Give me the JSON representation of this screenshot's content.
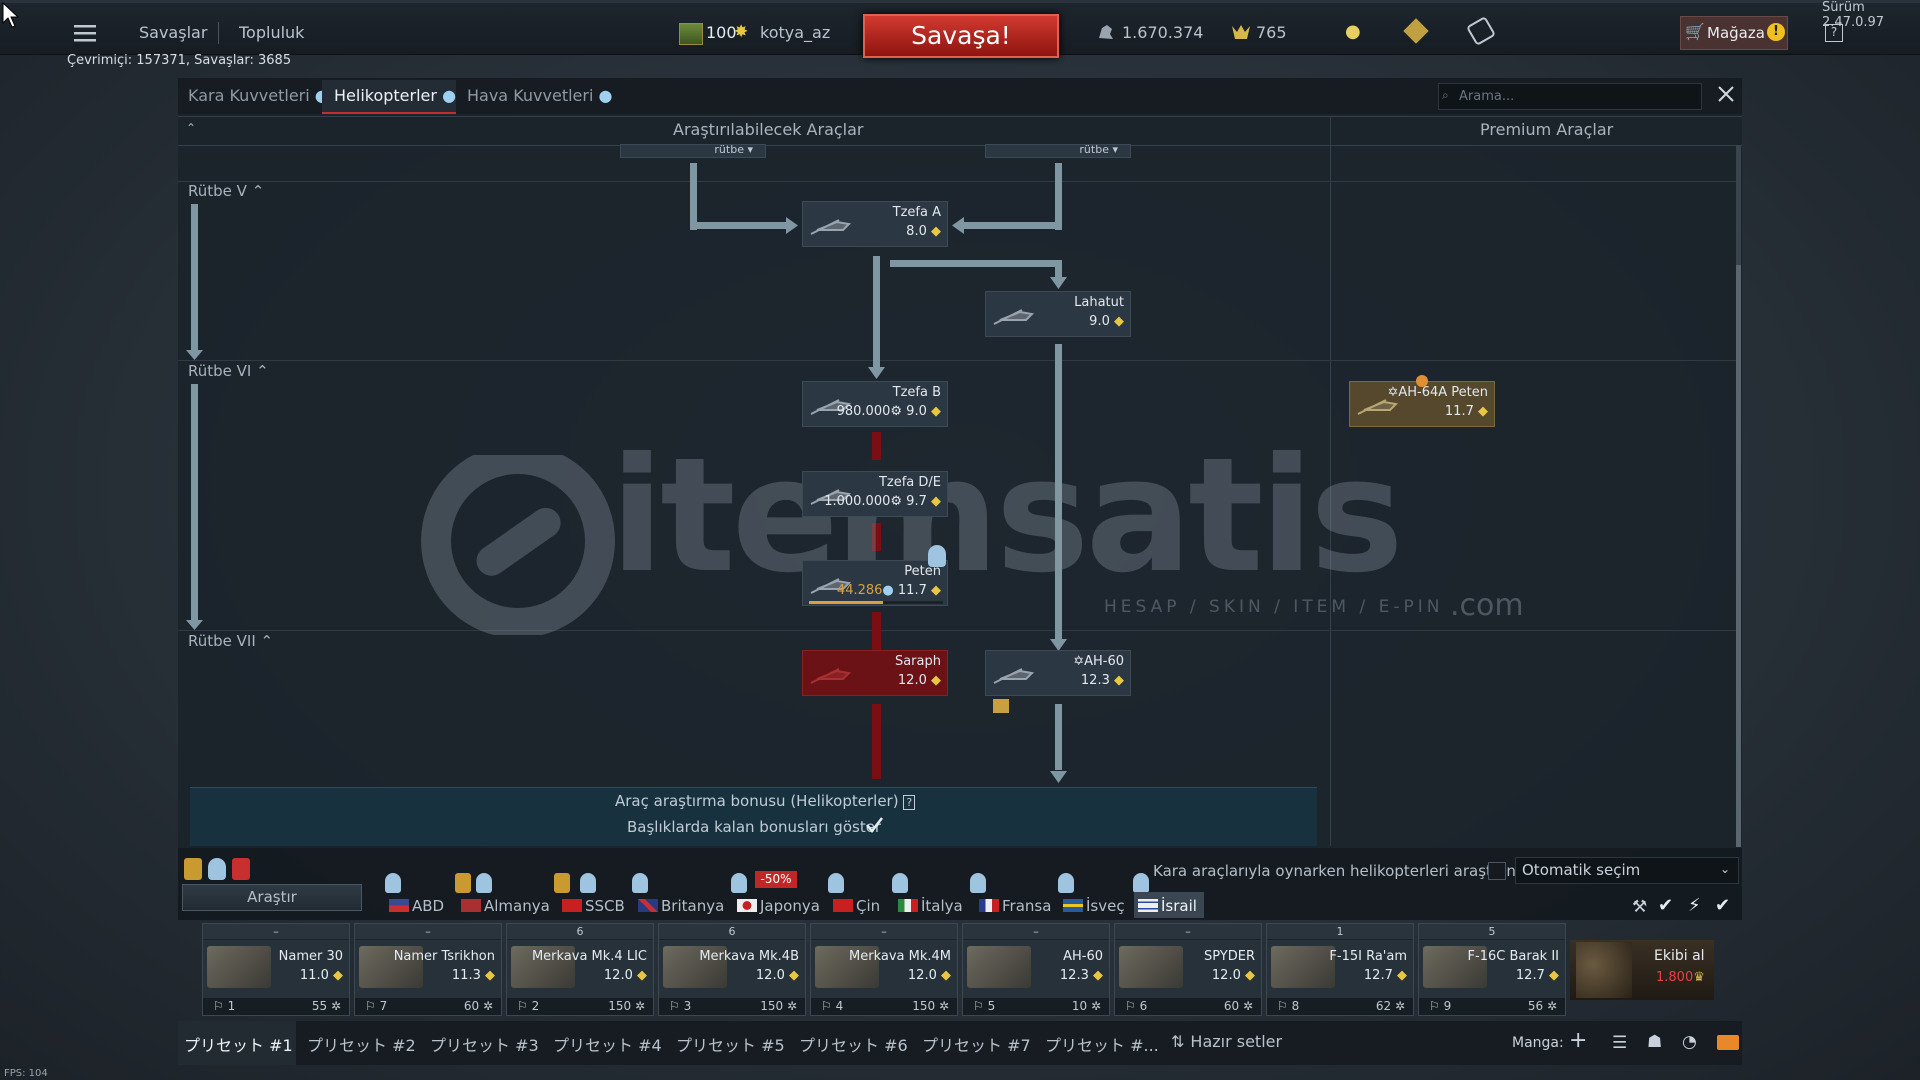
{
  "version": "Sürüm 2.47.0.97",
  "fps": "FPS: 104",
  "topbar": {
    "menu_battles": "Savaşlar",
    "menu_community": "Topluluk",
    "online": "Çevrimiçi: 157371, Savaşlar: 3685",
    "level": "100",
    "username": "kotya_az",
    "battle_button": "Savaşa!",
    "silver_lions": "1.670.374",
    "golden_eagles": "765",
    "shop_label": "Mağaza",
    "help": "?"
  },
  "tabs": {
    "ground": "Kara Kuvvetleri",
    "helicopters": "Helikopterler",
    "aviation": "Hava Kuvvetleri",
    "active": "helicopters"
  },
  "search": {
    "placeholder": "Arama..."
  },
  "tree": {
    "research_header": "Araştırılabilecek Araçlar",
    "premium_header": "Premium Araçlar",
    "cut_label_left": "rütbe",
    "cut_label_right": "rütbe",
    "ranks": [
      {
        "label": "Rütbe V"
      },
      {
        "label": "Rütbe VI"
      },
      {
        "label": "Rütbe VII"
      }
    ],
    "vehicles": [
      {
        "name": "Tzefa A",
        "cost": "",
        "br": "8.0"
      },
      {
        "name": "Lahatut",
        "cost": "",
        "br": "9.0"
      },
      {
        "name": "Tzefa B",
        "cost": "980.000",
        "br": "9.0"
      },
      {
        "name": "Tzefa D/E",
        "cost": "1.000.000",
        "br": "9.7"
      },
      {
        "name": "Peten",
        "cost": "44.286",
        "br": "11.7"
      },
      {
        "name": "Saraph",
        "cost": "",
        "br": "12.0"
      },
      {
        "name": "AH-60",
        "cost": "",
        "br": "12.3"
      },
      {
        "name": "AH-64A Peten",
        "cost": "",
        "br": "11.7"
      }
    ],
    "peten_progress": 0.55
  },
  "bonus": {
    "title": "Araç araştırma bonusu (Helikopterler)",
    "show_label": "Başlıklarda kalan bonusları göster"
  },
  "nationbar": {
    "research_button": "Araştır",
    "heli_research_label": "Kara araçlarıyla oynarken helikopterleri araştırın",
    "auto_select": "Otomatik seçim",
    "discount": "-50%",
    "nations": [
      "ABD",
      "Almanya",
      "SSCB",
      "Britanya",
      "Japonya",
      "Çin",
      "İtalya",
      "Fransa",
      "İsveç",
      "İsrail"
    ],
    "active_nation": "İsrail"
  },
  "crew": [
    {
      "top": "–",
      "name": "Namer 30",
      "br": "11.0",
      "n": "1",
      "pts": "55"
    },
    {
      "top": "–",
      "name": "Namer Tsrikhon",
      "br": "11.3",
      "n": "7",
      "pts": "60"
    },
    {
      "top": "6",
      "name": "Merkava Mk.4 LIC",
      "br": "12.0",
      "n": "2",
      "pts": "150"
    },
    {
      "top": "6",
      "name": "Merkava Mk.4B",
      "br": "12.0",
      "n": "3",
      "pts": "150"
    },
    {
      "top": "–",
      "name": "Merkava Mk.4M",
      "br": "12.0",
      "n": "4",
      "pts": "150"
    },
    {
      "top": "–",
      "name": "AH-60",
      "br": "12.3",
      "n": "5",
      "pts": "10"
    },
    {
      "top": "–",
      "name": "SPYDER",
      "br": "12.0",
      "n": "6",
      "pts": "60"
    },
    {
      "top": "1",
      "name": "F-15I Ra'am",
      "br": "12.7",
      "n": "8",
      "pts": "62"
    },
    {
      "top": "5",
      "name": "F-16C Barak II",
      "br": "12.7",
      "n": "9",
      "pts": "56"
    }
  ],
  "buy_crew": {
    "label": "Ekibi al",
    "price": "1.800"
  },
  "presets": [
    "プリセット #1",
    "プリセット #2",
    "プリセット #3",
    "プリセット #4",
    "プリセット #5",
    "プリセット #6",
    "プリセット #7",
    "プリセット #..."
  ],
  "ready_sets": "Hazır setler",
  "squad": "Manga:",
  "watermark": {
    "brand": "itemsatis",
    "tagline": "HESAP / SKIN / ITEM / E-PIN",
    "suffix": ".com"
  },
  "colors": {
    "accent_red": "#d23a30",
    "line": "#7f97a3",
    "bonus_bg": "#17313f"
  }
}
